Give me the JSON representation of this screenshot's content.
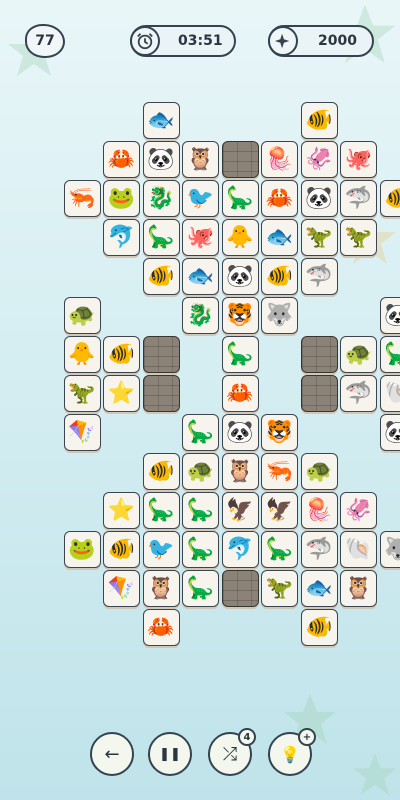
{
  "hud": {
    "level": "77",
    "timer": "03:51",
    "score": "2000",
    "timer_icon": "alarm-clock-icon",
    "score_icon": "sparkle-icon"
  },
  "colors": {
    "tile_bg": "#f7f4ee",
    "stone": "#8c8378",
    "outline": "#34434f"
  },
  "controls": [
    {
      "name": "undo-button",
      "icon": "arrow-left-icon",
      "glyph": "←"
    },
    {
      "name": "pause-button",
      "icon": "pause-icon",
      "glyph": "❚❚"
    },
    {
      "name": "shuffle-button",
      "icon": "shuffle-icon",
      "glyph": "⤮",
      "badge": "4"
    },
    {
      "name": "hint-button",
      "icon": "lightbulb-icon",
      "glyph": "💡",
      "badge": "+"
    }
  ],
  "tiles": [
    {
      "col": 3,
      "row": 0,
      "kind": "fish-pink",
      "glyph": "🐟"
    },
    {
      "col": 7,
      "row": 0,
      "kind": "anglerfish",
      "glyph": "🐠"
    },
    {
      "col": 2,
      "row": 1,
      "kind": "crab",
      "glyph": "🦀"
    },
    {
      "col": 3,
      "row": 1,
      "kind": "panda",
      "glyph": "🐼"
    },
    {
      "col": 4,
      "row": 1,
      "kind": "owl",
      "glyph": "🦉"
    },
    {
      "col": 5,
      "row": 1,
      "kind": "stone",
      "glyph": ""
    },
    {
      "col": 6,
      "row": 1,
      "kind": "jellyfish",
      "glyph": "🪼"
    },
    {
      "col": 7,
      "row": 1,
      "kind": "squid",
      "glyph": "🦑"
    },
    {
      "col": 8,
      "row": 1,
      "kind": "octopus",
      "glyph": "🐙"
    },
    {
      "col": 1,
      "row": 2,
      "kind": "shrimp",
      "glyph": "🦐"
    },
    {
      "col": 2,
      "row": 2,
      "kind": "frog",
      "glyph": "🐸"
    },
    {
      "col": 3,
      "row": 2,
      "kind": "seahorse",
      "glyph": "🐉"
    },
    {
      "col": 4,
      "row": 2,
      "kind": "bird",
      "glyph": "🐦"
    },
    {
      "col": 5,
      "row": 2,
      "kind": "dinosaur",
      "glyph": "🦕"
    },
    {
      "col": 6,
      "row": 2,
      "kind": "crab",
      "glyph": "🦀"
    },
    {
      "col": 7,
      "row": 2,
      "kind": "panda",
      "glyph": "🐼"
    },
    {
      "col": 8,
      "row": 2,
      "kind": "shark",
      "glyph": "🦈"
    },
    {
      "col": 9,
      "row": 2,
      "kind": "tropical-fish",
      "glyph": "🐠"
    },
    {
      "col": 2,
      "row": 3,
      "kind": "dolphin",
      "glyph": "🐬"
    },
    {
      "col": 3,
      "row": 3,
      "kind": "dinosaur",
      "glyph": "🦕"
    },
    {
      "col": 4,
      "row": 3,
      "kind": "octopus",
      "glyph": "🐙"
    },
    {
      "col": 5,
      "row": 3,
      "kind": "chick",
      "glyph": "🐥"
    },
    {
      "col": 6,
      "row": 3,
      "kind": "goldfish",
      "glyph": "🐟"
    },
    {
      "col": 7,
      "row": 3,
      "kind": "pterodactyl",
      "glyph": "🦖"
    },
    {
      "col": 8,
      "row": 3,
      "kind": "t-rex",
      "glyph": "🦖"
    },
    {
      "col": 3,
      "row": 4,
      "kind": "anglerfish",
      "glyph": "🐠"
    },
    {
      "col": 4,
      "row": 4,
      "kind": "fish-pink",
      "glyph": "🐟"
    },
    {
      "col": 5,
      "row": 4,
      "kind": "panda",
      "glyph": "🐼"
    },
    {
      "col": 6,
      "row": 4,
      "kind": "anglerfish",
      "glyph": "🐠"
    },
    {
      "col": 7,
      "row": 4,
      "kind": "hammerhead",
      "glyph": "🦈"
    },
    {
      "col": 1,
      "row": 5,
      "kind": "turtle",
      "glyph": "🐢"
    },
    {
      "col": 4,
      "row": 5,
      "kind": "seahorse",
      "glyph": "🐉"
    },
    {
      "col": 5,
      "row": 5,
      "kind": "tiger",
      "glyph": "🐯"
    },
    {
      "col": 6,
      "row": 5,
      "kind": "wolf",
      "glyph": "🐺"
    },
    {
      "col": 9,
      "row": 5,
      "kind": "bamboo-panda",
      "glyph": "🐼"
    },
    {
      "col": 1,
      "row": 6,
      "kind": "chick",
      "glyph": "🐥"
    },
    {
      "col": 2,
      "row": 6,
      "kind": "anglerfish",
      "glyph": "🐠"
    },
    {
      "col": 3,
      "row": 6,
      "kind": "stone",
      "glyph": ""
    },
    {
      "col": 5,
      "row": 6,
      "kind": "dinosaur",
      "glyph": "🦕"
    },
    {
      "col": 7,
      "row": 6,
      "kind": "stone",
      "glyph": ""
    },
    {
      "col": 8,
      "row": 6,
      "kind": "turtle",
      "glyph": "🐢"
    },
    {
      "col": 9,
      "row": 6,
      "kind": "dinosaur",
      "glyph": "🦕"
    },
    {
      "col": 1,
      "row": 7,
      "kind": "pterodactyl",
      "glyph": "🦖"
    },
    {
      "col": 2,
      "row": 7,
      "kind": "starfish",
      "glyph": "⭐"
    },
    {
      "col": 3,
      "row": 7,
      "kind": "stone",
      "glyph": ""
    },
    {
      "col": 5,
      "row": 7,
      "kind": "crab",
      "glyph": "🦀"
    },
    {
      "col": 7,
      "row": 7,
      "kind": "stone",
      "glyph": ""
    },
    {
      "col": 8,
      "row": 7,
      "kind": "hammerhead",
      "glyph": "🦈"
    },
    {
      "col": 9,
      "row": 7,
      "kind": "shell",
      "glyph": "🐚"
    },
    {
      "col": 1,
      "row": 8,
      "kind": "stingray",
      "glyph": "🪁"
    },
    {
      "col": 4,
      "row": 8,
      "kind": "dinosaur",
      "glyph": "🦕"
    },
    {
      "col": 5,
      "row": 8,
      "kind": "panda",
      "glyph": "🐼"
    },
    {
      "col": 6,
      "row": 8,
      "kind": "tiger",
      "glyph": "🐯"
    },
    {
      "col": 9,
      "row": 8,
      "kind": "bamboo-panda",
      "glyph": "🐼"
    },
    {
      "col": 3,
      "row": 9,
      "kind": "tropical-fish",
      "glyph": "🐠"
    },
    {
      "col": 4,
      "row": 9,
      "kind": "turtle",
      "glyph": "🐢"
    },
    {
      "col": 5,
      "row": 9,
      "kind": "owl",
      "glyph": "🦉"
    },
    {
      "col": 6,
      "row": 9,
      "kind": "shrimp",
      "glyph": "🦐"
    },
    {
      "col": 7,
      "row": 9,
      "kind": "turtle",
      "glyph": "🐢"
    },
    {
      "col": 2,
      "row": 10,
      "kind": "starfish",
      "glyph": "⭐"
    },
    {
      "col": 3,
      "row": 10,
      "kind": "stegosaurus",
      "glyph": "🦕"
    },
    {
      "col": 4,
      "row": 10,
      "kind": "stegosaurus",
      "glyph": "🦕"
    },
    {
      "col": 5,
      "row": 10,
      "kind": "vulture",
      "glyph": "🦅"
    },
    {
      "col": 6,
      "row": 10,
      "kind": "vulture",
      "glyph": "🦅"
    },
    {
      "col": 7,
      "row": 10,
      "kind": "jellyfish",
      "glyph": "🪼"
    },
    {
      "col": 8,
      "row": 10,
      "kind": "squid",
      "glyph": "🦑"
    },
    {
      "col": 1,
      "row": 11,
      "kind": "frog",
      "glyph": "🐸"
    },
    {
      "col": 2,
      "row": 11,
      "kind": "clownfish",
      "glyph": "🐠"
    },
    {
      "col": 3,
      "row": 11,
      "kind": "bird",
      "glyph": "🐦"
    },
    {
      "col": 4,
      "row": 11,
      "kind": "stegosaurus",
      "glyph": "🦕"
    },
    {
      "col": 5,
      "row": 11,
      "kind": "dolphin",
      "glyph": "🐬"
    },
    {
      "col": 6,
      "row": 11,
      "kind": "stegosaurus",
      "glyph": "🦕"
    },
    {
      "col": 7,
      "row": 11,
      "kind": "shark",
      "glyph": "🦈"
    },
    {
      "col": 8,
      "row": 11,
      "kind": "shell",
      "glyph": "🐚"
    },
    {
      "col": 9,
      "row": 11,
      "kind": "wolf",
      "glyph": "🐺"
    },
    {
      "col": 2,
      "row": 12,
      "kind": "stingray",
      "glyph": "🪁"
    },
    {
      "col": 3,
      "row": 12,
      "kind": "owl",
      "glyph": "🦉"
    },
    {
      "col": 4,
      "row": 12,
      "kind": "dinosaur",
      "glyph": "🦕"
    },
    {
      "col": 5,
      "row": 12,
      "kind": "stone",
      "glyph": ""
    },
    {
      "col": 6,
      "row": 12,
      "kind": "t-rex",
      "glyph": "🦖"
    },
    {
      "col": 7,
      "row": 12,
      "kind": "goldfish",
      "glyph": "🐟"
    },
    {
      "col": 8,
      "row": 12,
      "kind": "owl",
      "glyph": "🦉"
    },
    {
      "col": 3,
      "row": 13,
      "kind": "crab",
      "glyph": "🦀"
    },
    {
      "col": 7,
      "row": 13,
      "kind": "clownfish",
      "glyph": "🐠"
    }
  ]
}
